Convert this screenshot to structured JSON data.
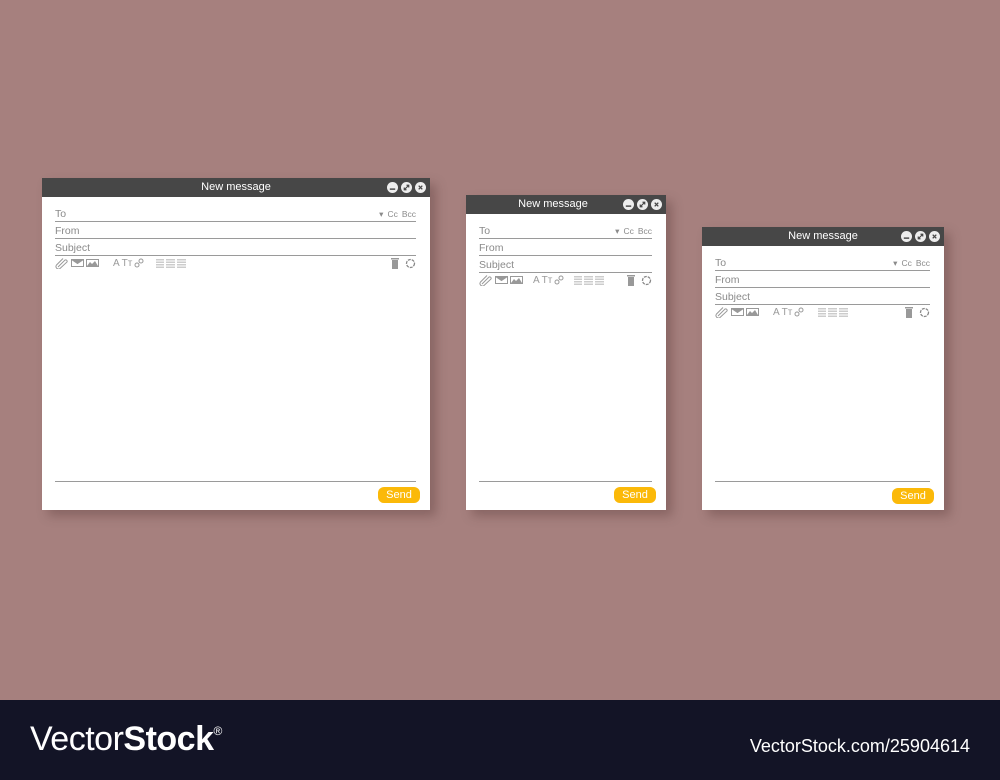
{
  "windows": [
    {
      "title": "New message",
      "fields": {
        "to": "To",
        "from": "From",
        "subject": "Subject"
      },
      "cc_label": "Cc",
      "bcc_label": "Bcc",
      "send_label": "Send",
      "icons": [
        "attach-icon",
        "envelope-icon",
        "image-icon",
        "font-size-icon",
        "text-style-icon",
        "link-icon",
        "align-icon",
        "trash-icon",
        "settings-icon"
      ]
    },
    {
      "title": "New message",
      "fields": {
        "to": "To",
        "from": "From",
        "subject": "Subject"
      },
      "cc_label": "Cc",
      "bcc_label": "Bcc",
      "send_label": "Send"
    },
    {
      "title": "New message",
      "fields": {
        "to": "To",
        "from": "From",
        "subject": "Subject"
      },
      "cc_label": "Cc",
      "bcc_label": "Bcc",
      "send_label": "Send"
    }
  ],
  "toolbar": {
    "font_a": "A",
    "font_tt": "Tт"
  },
  "colors": {
    "background": "#a6807e",
    "titlebar": "#474747",
    "send": "#fbb909",
    "footer": "#131426"
  },
  "footer": {
    "brand_light": "Vector",
    "brand_bold": "Stock",
    "registered": "®",
    "site": "VectorStock.com/25904614"
  }
}
